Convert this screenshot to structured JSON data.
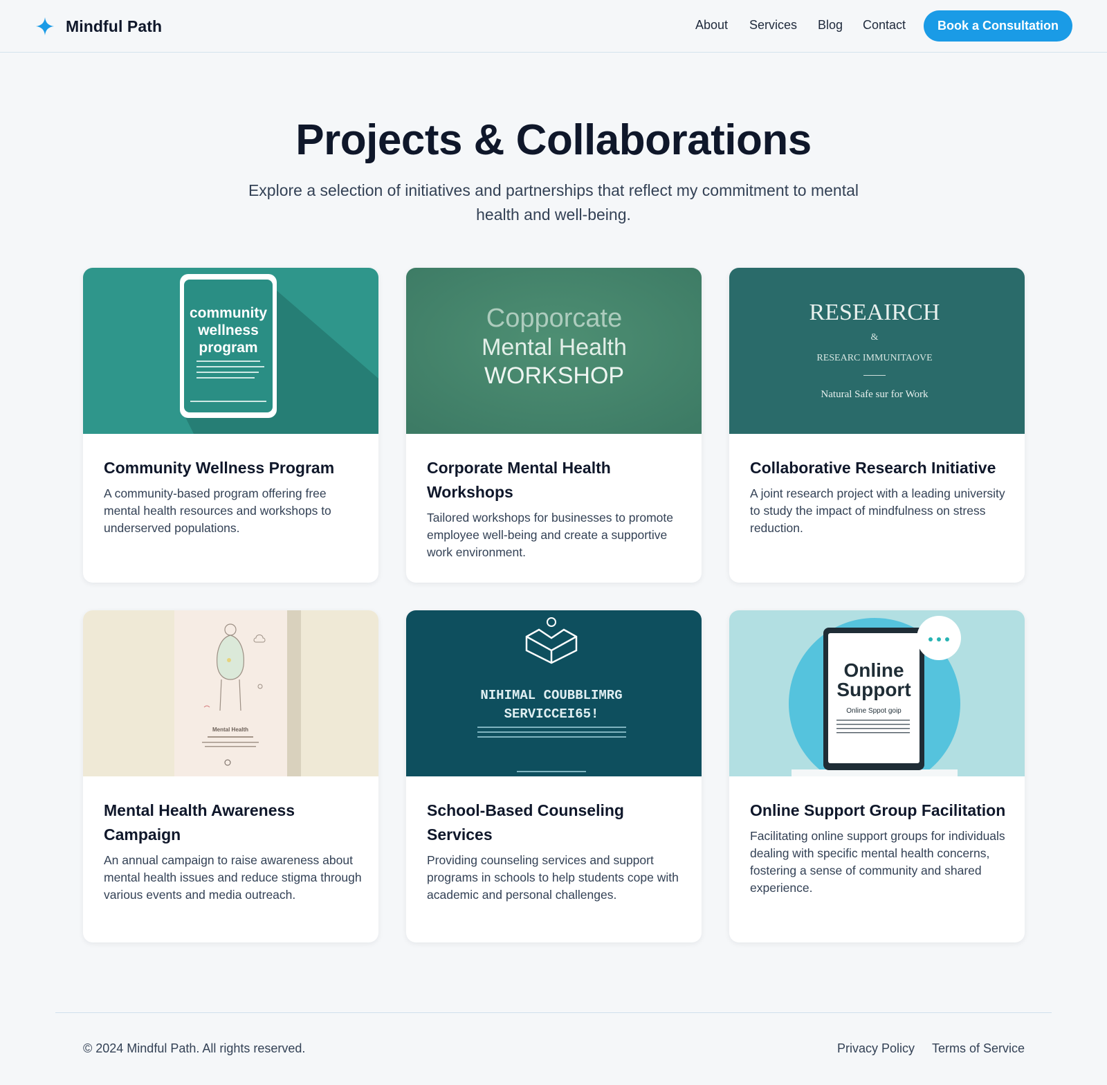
{
  "header": {
    "brand": "Mindful Path",
    "nav": [
      "About",
      "Services",
      "Blog",
      "Contact"
    ],
    "cta": "Book a Consultation"
  },
  "hero": {
    "title": "Projects & Collaborations",
    "subtitle": "Explore a selection of initiatives and partnerships that reflect my commitment to mental health and well-being."
  },
  "projects": [
    {
      "title": "Community Wellness Program",
      "description": "A community-based program offering free mental health resources and workshops to underserved populations.",
      "image_text": [
        "community",
        "wellness",
        "program"
      ]
    },
    {
      "title": "Corporate Mental Health Workshops",
      "description": "Tailored workshops for businesses to promote employee well-being and create a supportive work environment.",
      "image_text": [
        "Copporcate",
        "Mental Health",
        "WORKSHOP"
      ]
    },
    {
      "title": "Collaborative Research Initiative",
      "description": "A joint research project with a leading university to study the impact of mindfulness on stress reduction.",
      "image_text": [
        "RESEAIRCH",
        "&",
        "RESEARC IMMUNITAOVE",
        "Natural Safe sur for Work"
      ]
    },
    {
      "title": "Mental Health Awareness Campaign",
      "description": "An annual campaign to raise awareness about mental health issues and reduce stigma through various events and media outreach.",
      "image_text": [
        "Mental Health"
      ]
    },
    {
      "title": "School-Based Counseling Services",
      "description": "Providing counseling services and support programs in schools to help students cope with academic and personal challenges.",
      "image_text": [
        "NIHIMAL COUBBLIMRG",
        "SERVICCEI65!"
      ]
    },
    {
      "title": "Online Support Group Facilitation",
      "description": "Facilitating online support groups for individuals dealing with specific mental health concerns, fostering a sense of community and shared experience.",
      "image_text": [
        "Online",
        "Support",
        "Online Sppot goip"
      ]
    }
  ],
  "footer": {
    "copyright": "© 2024 Mindful Path. All rights reserved.",
    "links": [
      "Privacy Policy",
      "Terms of Service"
    ]
  },
  "colors": {
    "accent": "#1a9be6",
    "background": "#f5f7f9",
    "heading": "#0f172a",
    "body_text": "#334155"
  }
}
